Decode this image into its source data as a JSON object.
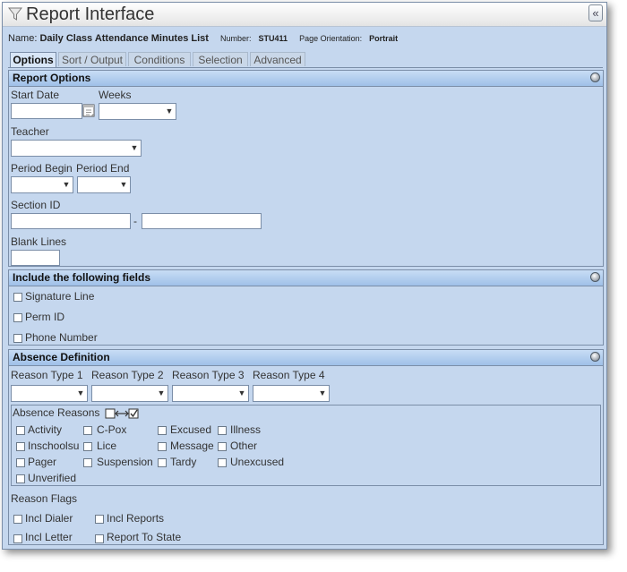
{
  "window": {
    "title": "Report Interface",
    "collapse_label": "«"
  },
  "report": {
    "name_label": "Name:",
    "name": "Daily Class Attendance Minutes List",
    "number_label": "Number:",
    "number": "STU411",
    "orientation_label": "Page Orientation:",
    "orientation": "Portrait"
  },
  "tabs": [
    "Options",
    "Sort / Output",
    "Conditions",
    "Selection",
    "Advanced"
  ],
  "report_options": {
    "title": "Report Options",
    "start_date_label": "Start Date",
    "weeks_label": "Weeks",
    "teacher_label": "Teacher",
    "period_begin_label": "Period Begin",
    "period_end_label": "Period End",
    "section_id_label": "Section ID",
    "section_sep": "-",
    "blank_lines_label": "Blank Lines"
  },
  "include_fields": {
    "title": "Include the following fields",
    "items": [
      "Signature Line",
      "Perm ID",
      "Phone Number"
    ]
  },
  "absence": {
    "title": "Absence Definition",
    "reason_types": [
      "Reason Type 1",
      "Reason Type 2",
      "Reason Type 3",
      "Reason Type 4"
    ],
    "reasons_label": "Absence Reasons",
    "reasons": [
      "Activity",
      "C-Pox",
      "Excused",
      "Illness",
      "Inschoolsu",
      "Lice",
      "Message",
      "Other",
      "Pager",
      "Suspension",
      "Tardy",
      "Unexcused",
      "Unverified"
    ],
    "flags_label": "Reason Flags",
    "flags": [
      "Incl Dialer",
      "Incl Reports",
      "Incl Letter",
      "Report To State"
    ]
  },
  "colors": {
    "panel": "#c5d7ee",
    "header": "#9fc0e8",
    "border": "#7b8ea8"
  }
}
